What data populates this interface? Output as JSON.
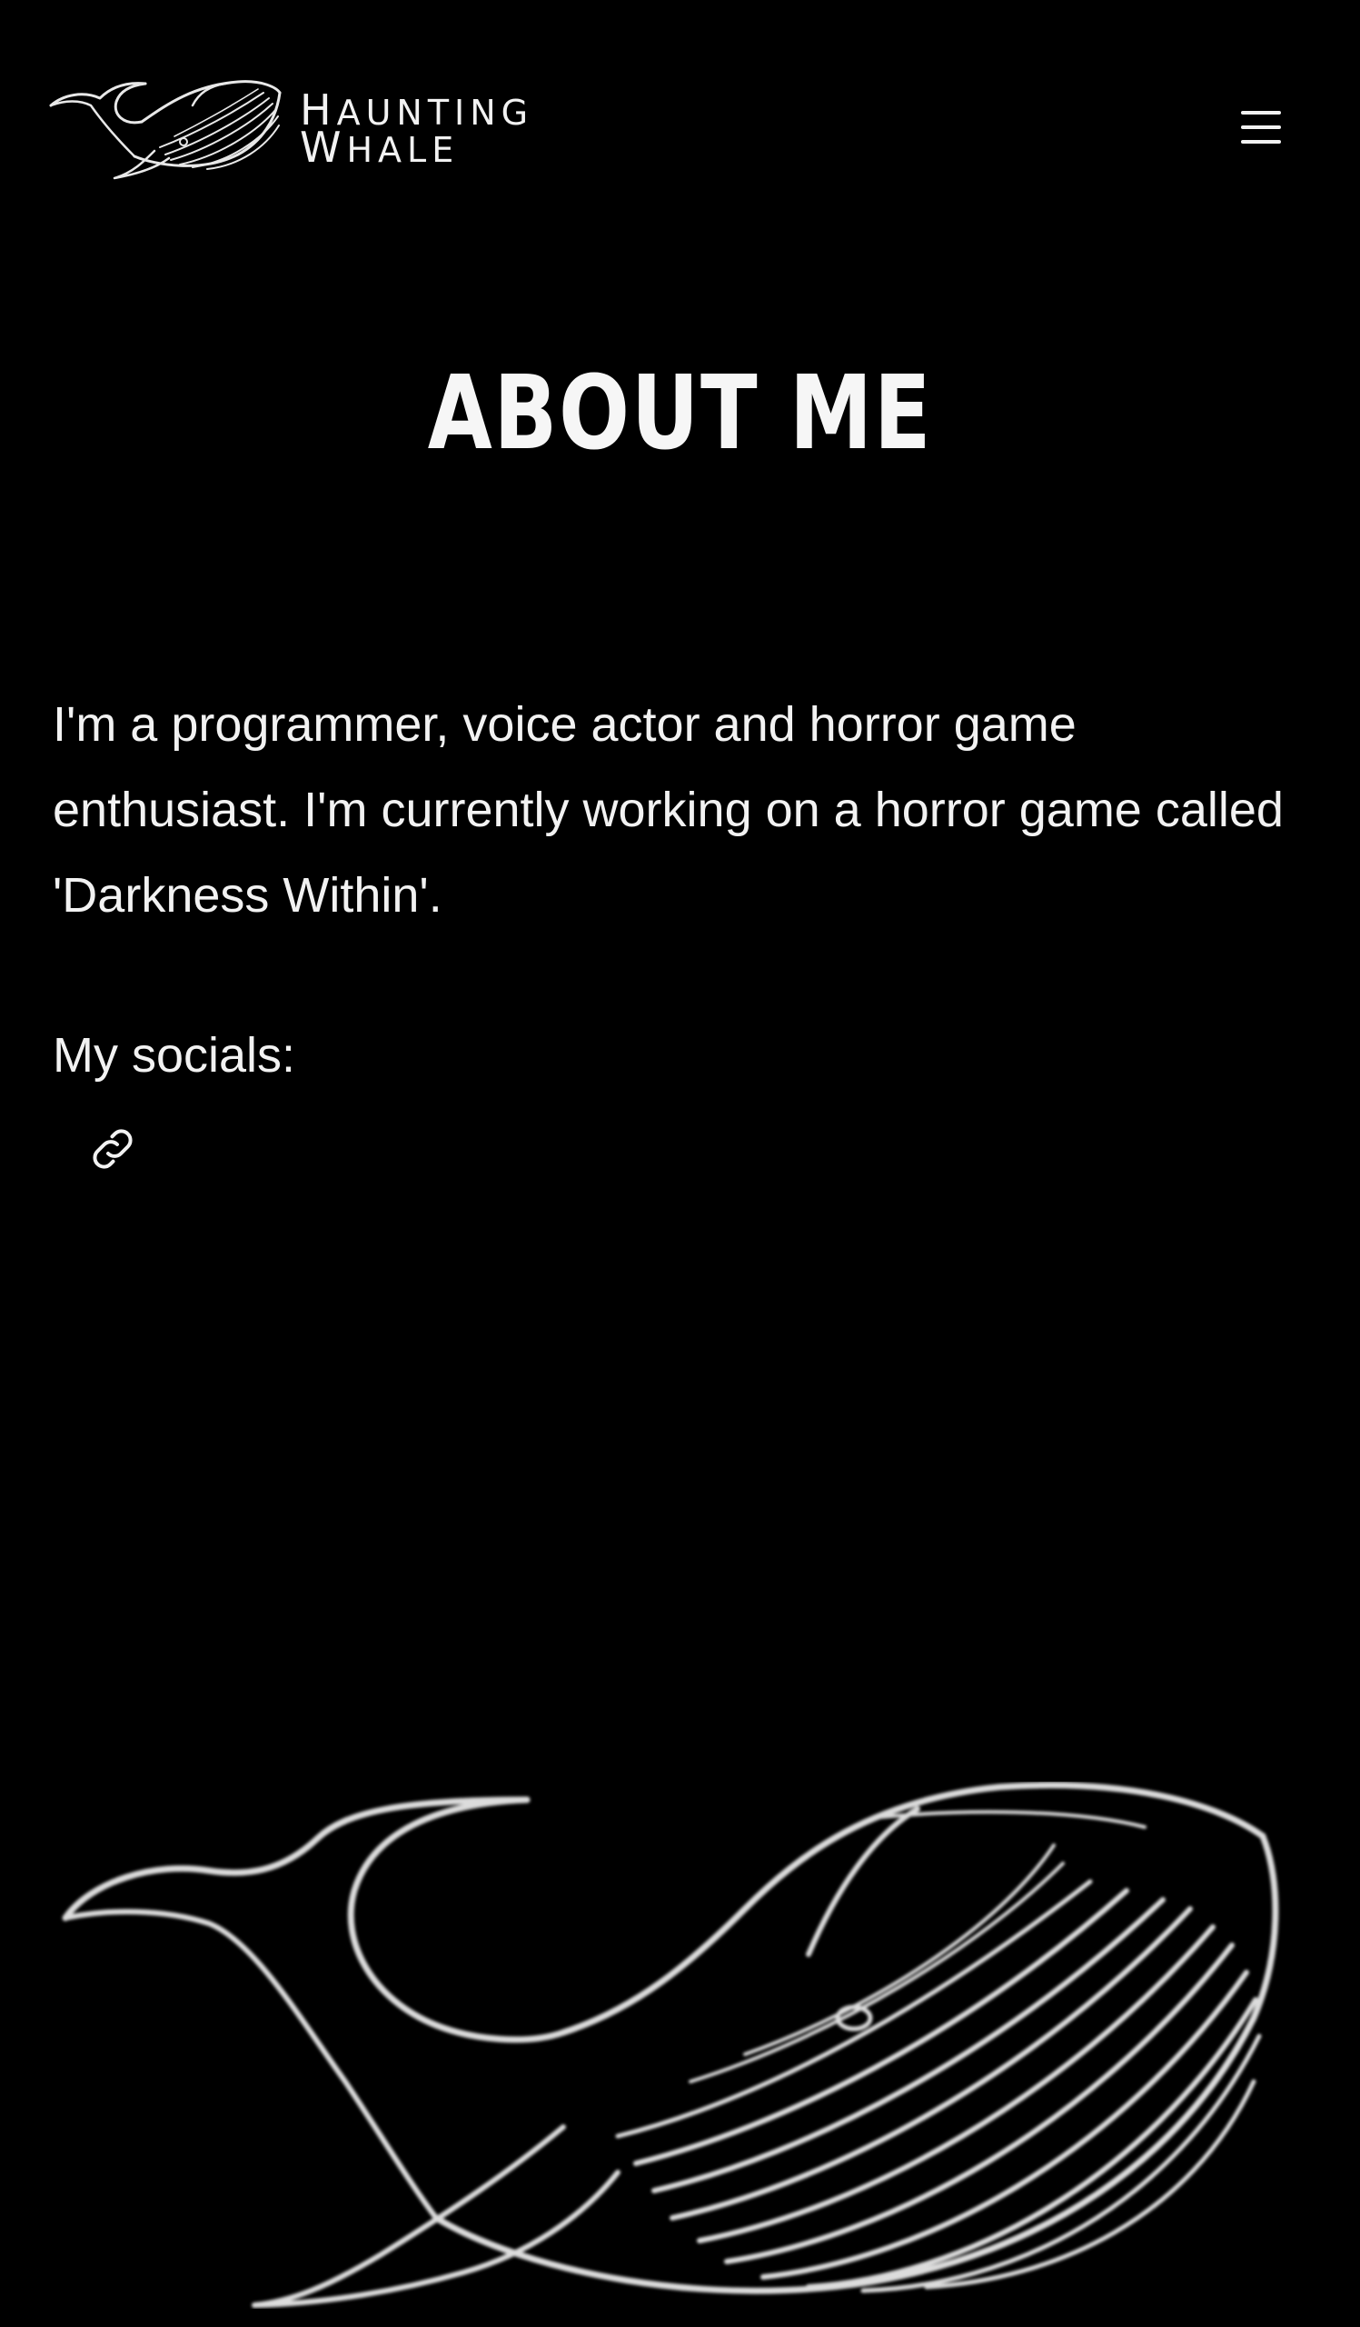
{
  "header": {
    "logo_icon": "whale-logo-icon",
    "logo_line1": "Haunting",
    "logo_line2": "Whale",
    "menu_icon": "hamburger-menu-icon"
  },
  "main": {
    "title": "ABOUT ME",
    "bio": "I'm a programmer, voice actor and horror game enthusiast. I'm currently working on a horror game called 'Darkness Within'.",
    "socials_label": "My socials:",
    "social_links": [
      {
        "icon": "link-icon"
      }
    ]
  },
  "decoration": {
    "illustration": "whale-illustration"
  },
  "colors": {
    "background": "#000000",
    "text": "#f2f2f2"
  }
}
